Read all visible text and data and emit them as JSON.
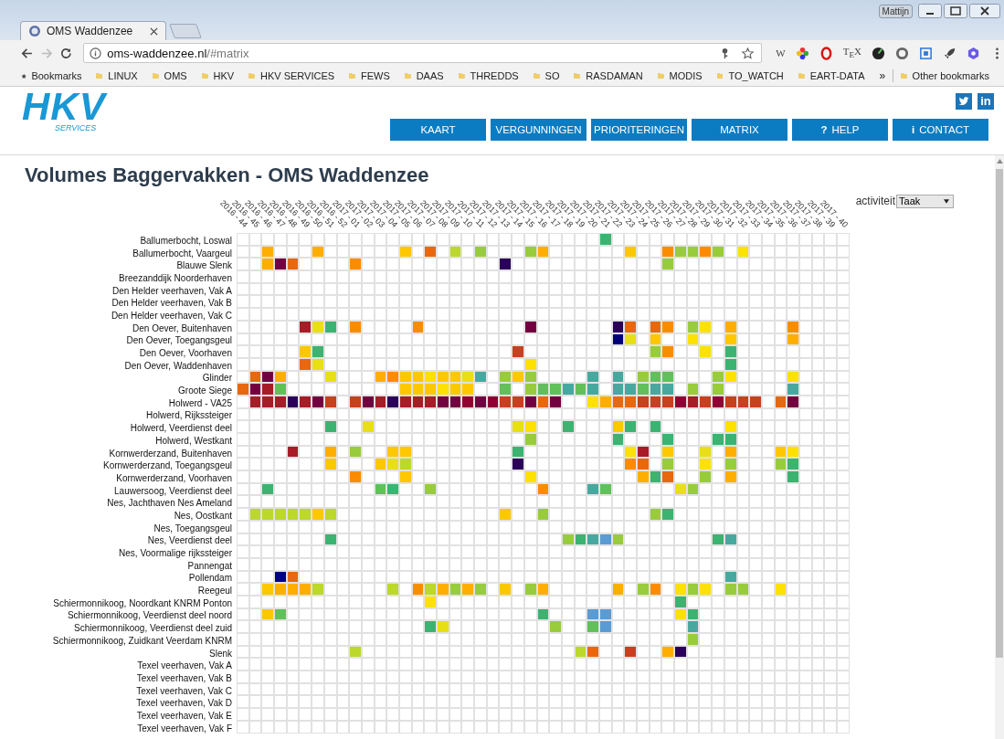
{
  "browser": {
    "user": "Mattijn",
    "tab": {
      "title": "OMS Waddenzee"
    },
    "address": {
      "host": "oms-waddenzee.nl",
      "path": "/#matrix"
    },
    "extensions": [
      {
        "kind": "letter",
        "label": "W"
      },
      {
        "kind": "wheel"
      },
      {
        "kind": "opera"
      },
      {
        "kind": "letter",
        "label": "T$_{E}$X"
      },
      {
        "kind": "dark"
      },
      {
        "kind": "ring"
      },
      {
        "kind": "target"
      },
      {
        "kind": "rocket"
      },
      {
        "kind": "hex"
      }
    ],
    "bookmarks": {
      "label": "Bookmarks",
      "folders": [
        "LINUX",
        "OMS",
        "HKV",
        "HKV SERVICES",
        "FEWS",
        "DAAS",
        "THREDDS",
        "SO",
        "RASDAMAN",
        "MODIS",
        "TO_WATCH",
        "EART-DATA"
      ],
      "overflow": "»",
      "other": "Other bookmarks"
    }
  },
  "header": {
    "logo": {
      "name": "HKV",
      "tagline": "SERVICES"
    },
    "social": [
      {
        "kind": "twitter"
      },
      {
        "kind": "linkedin",
        "label": "in"
      }
    ],
    "nav": [
      {
        "label": "KAART"
      },
      {
        "label": "VERGUNNINGEN"
      },
      {
        "label": "PRIORITERINGEN"
      },
      {
        "label": "MATRIX"
      },
      {
        "label": "HELP",
        "icon": "?"
      },
      {
        "label": "CONTACT",
        "icon": "i"
      }
    ]
  },
  "page": {
    "title": "Volumes Baggervakken - OMS Waddenzee",
    "filter": {
      "label": "activiteit",
      "value": "Taak"
    }
  },
  "matrix": {
    "columns": [
      "2016 - 44",
      "2016 - 45",
      "2016 - 46",
      "2016 - 47",
      "2016 - 48",
      "2016 - 49",
      "2016 - 50",
      "2016 - 51",
      "2016 - 52",
      "2017 - 01",
      "2017 - 02",
      "2017 - 03",
      "2017 - 04",
      "2017 - 05",
      "2017 - 06",
      "2017 - 07",
      "2017 - 08",
      "2017 - 09",
      "2017 - 10",
      "2017 - 11",
      "2017 - 12",
      "2017 - 13",
      "2017 - 14",
      "2017 - 15",
      "2017 - 16",
      "2017 - 17",
      "2017 - 18",
      "2017 - 19",
      "2017 - 20",
      "2017 - 21",
      "2017 - 22",
      "2017 - 23",
      "2017 - 24",
      "2017 - 25",
      "2017 - 26",
      "2017 - 27",
      "2017 - 28",
      "2017 - 29",
      "2017 - 30",
      "2017 - 31",
      "2017 - 32",
      "2017 - 33",
      "2017 - 34",
      "2017 - 35",
      "2017 - 36",
      "2017 - 37",
      "2017 - 38",
      "2017 - 39",
      "2017 - 40"
    ],
    "rows": [
      {
        "label": "Ballumerbocht, Loswal",
        "cells": [
          null,
          null,
          null,
          null,
          null,
          null,
          null,
          null,
          null,
          null,
          null,
          null,
          null,
          null,
          null,
          null,
          null,
          null,
          null,
          null,
          null,
          null,
          null,
          null,
          null,
          null,
          null,
          null,
          null,
          {
            "color": "#3cb371"
          },
          null,
          null,
          null,
          null,
          null,
          null,
          null,
          null,
          null,
          null,
          null,
          null,
          null,
          null,
          null,
          null,
          null,
          null,
          null
        ]
      },
      {
        "label": "Ballumerbocht, Vaargeul",
        "cells": [
          null,
          null,
          {
            "color": "#fdae00"
          },
          null,
          null,
          null,
          {
            "color": "#fdae00"
          },
          null,
          null,
          null,
          null,
          null,
          null,
          {
            "color": "#fdc800"
          },
          null,
          {
            "color": "#e8680f"
          },
          null,
          {
            "color": "#bcd82a"
          },
          null,
          {
            "color": "#98cc3c"
          },
          null,
          null,
          null,
          {
            "color": "#98cc3c"
          },
          {
            "color": "#fdae00"
          },
          null,
          null,
          null,
          null,
          null,
          null,
          {
            "color": "#fdc800"
          },
          null,
          null,
          {
            "color": "#fb8c00"
          },
          {
            "color": "#98cc3c"
          },
          {
            "color": "#98cc3c"
          },
          {
            "color": "#fb8c00"
          },
          {
            "color": "#98cc3c"
          },
          null,
          {
            "color": "#fde100"
          },
          null,
          null,
          null,
          null,
          null,
          null,
          null,
          null
        ]
      },
      {
        "label": "Blauwe Slenk",
        "cells": [
          null,
          null,
          {
            "color": "#fdae00"
          },
          {
            "color": "#720040"
          },
          {
            "color": "#e8680f"
          },
          null,
          null,
          null,
          null,
          {
            "color": "#fb8c00"
          },
          null,
          null,
          null,
          null,
          null,
          null,
          null,
          null,
          null,
          null,
          null,
          {
            "color": "#2a0058"
          },
          null,
          null,
          null,
          null,
          null,
          null,
          null,
          null,
          null,
          null,
          null,
          null,
          {
            "color": "#98cc3c"
          },
          null,
          null,
          null,
          null,
          null,
          null,
          null,
          null,
          null,
          null,
          null,
          null,
          null,
          null
        ]
      },
      {
        "label": "Breezanddijk Noorderhaven"
      },
      {
        "label": "Den Helder veerhaven, Vak A"
      },
      {
        "label": "Den Helder veerhaven, Vak B"
      },
      {
        "label": "Den Helder veerhaven, Vak C"
      },
      {
        "label": "Den Oever, Buitenhaven",
        "cells": [
          null,
          null,
          null,
          null,
          null,
          {
            "color": "#a81c28"
          },
          {
            "color": "#e8e014"
          },
          {
            "color": "#3cb371"
          },
          null,
          {
            "color": "#fb8c00"
          },
          null,
          null,
          null,
          null,
          {
            "color": "#fb8c00"
          },
          null,
          null,
          null,
          null,
          null,
          null,
          null,
          null,
          {
            "color": "#720040"
          },
          null,
          null,
          null,
          null,
          null,
          null,
          {
            "color": "#2a0058"
          },
          {
            "color": "#e8680f"
          },
          null,
          {
            "color": "#e8680f"
          },
          {
            "color": "#fb8c00"
          },
          null,
          {
            "color": "#98cc3c"
          },
          {
            "color": "#fde100"
          },
          null,
          {
            "color": "#fdae00"
          },
          null,
          null,
          null,
          null,
          {
            "color": "#fb8c00"
          },
          null,
          null,
          null,
          null
        ]
      },
      {
        "label": "Den Oever, Toegangsgeul",
        "cells": [
          null,
          null,
          null,
          null,
          null,
          null,
          null,
          null,
          null,
          null,
          null,
          null,
          null,
          null,
          null,
          null,
          null,
          null,
          null,
          null,
          null,
          null,
          null,
          null,
          null,
          null,
          null,
          null,
          null,
          null,
          {
            "color": "#000080"
          },
          {
            "color": "#e8e014"
          },
          null,
          {
            "color": "#fdc800"
          },
          null,
          null,
          {
            "color": "#fde100"
          },
          null,
          null,
          {
            "color": "#fdc800"
          },
          null,
          null,
          null,
          null,
          {
            "color": "#fdae00"
          },
          null,
          null,
          null,
          null
        ]
      },
      {
        "label": "Den Oever, Voorhaven",
        "cells": [
          null,
          null,
          null,
          null,
          null,
          {
            "color": "#fdc800"
          },
          {
            "color": "#3cb371"
          },
          null,
          null,
          null,
          null,
          null,
          null,
          null,
          null,
          null,
          null,
          null,
          null,
          null,
          null,
          null,
          {
            "color": "#c8401e"
          },
          null,
          null,
          null,
          null,
          null,
          null,
          null,
          null,
          null,
          null,
          {
            "color": "#98cc3c"
          },
          {
            "color": "#fb8c00"
          },
          null,
          null,
          {
            "color": "#fde100"
          },
          null,
          {
            "color": "#3cb371"
          },
          null,
          null,
          null,
          null,
          null,
          null,
          null,
          null,
          null
        ]
      },
      {
        "label": "Den Oever, Waddenhaven",
        "cells": [
          null,
          null,
          null,
          null,
          null,
          {
            "color": "#e8680f"
          },
          {
            "color": "#e8e014"
          },
          null,
          null,
          null,
          null,
          null,
          null,
          null,
          null,
          null,
          null,
          null,
          null,
          null,
          null,
          null,
          null,
          {
            "color": "#fde100"
          },
          null,
          null,
          null,
          null,
          null,
          null,
          null,
          null,
          null,
          null,
          null,
          null,
          null,
          null,
          null,
          {
            "color": "#3cb371"
          },
          null,
          null,
          null,
          null,
          null,
          null,
          null,
          null,
          null
        ]
      },
      {
        "label": "Glinder",
        "cells": [
          null,
          {
            "color": "#e8680f"
          },
          {
            "color": "#720040"
          },
          {
            "color": "#fdae00"
          },
          null,
          null,
          null,
          {
            "color": "#e8e014"
          },
          null,
          null,
          null,
          {
            "color": "#fdae00"
          },
          {
            "color": "#fb8c00"
          },
          {
            "color": "#fdc800"
          },
          {
            "color": "#fdc800"
          },
          {
            "color": "#fde100"
          },
          {
            "color": "#fdc800"
          },
          {
            "color": "#fdc800"
          },
          {
            "color": "#e8e014"
          },
          {
            "color": "#48a8a0"
          },
          null,
          {
            "color": "#98cc3c"
          },
          {
            "color": "#fdc800"
          },
          {
            "color": "#98cc3c"
          },
          null,
          null,
          null,
          null,
          {
            "color": "#48a8a0"
          },
          null,
          {
            "color": "#48a8a0"
          },
          null,
          {
            "color": "#98cc3c"
          },
          {
            "color": "#62c05a"
          },
          {
            "color": "#62c05a"
          },
          null,
          null,
          null,
          {
            "color": "#98cc3c"
          },
          {
            "color": "#fde100"
          },
          null,
          null,
          null,
          null,
          {
            "color": "#fde100"
          },
          null,
          null,
          null,
          null
        ]
      },
      {
        "label": "Groote Siege",
        "cells": [
          {
            "color": "#e8680f"
          },
          {
            "color": "#720040"
          },
          {
            "color": "#a81c28"
          },
          {
            "color": "#62c05a"
          },
          null,
          null,
          null,
          null,
          null,
          null,
          null,
          null,
          null,
          {
            "color": "#fdc800"
          },
          {
            "color": "#fdc800"
          },
          {
            "color": "#fdc800"
          },
          {
            "color": "#fde100"
          },
          {
            "color": "#fdc800"
          },
          {
            "color": "#fdc800"
          },
          null,
          null,
          {
            "color": "#62c05a"
          },
          null,
          {
            "color": "#98cc3c"
          },
          {
            "color": "#62c05a"
          },
          {
            "color": "#62c05a"
          },
          {
            "color": "#48a8a0"
          },
          {
            "color": "#62c05a"
          },
          {
            "color": "#48a8a0"
          },
          null,
          {
            "color": "#48a8a0"
          },
          {
            "color": "#48a8a0"
          },
          {
            "color": "#62c05a"
          },
          {
            "color": "#48a8a0"
          },
          {
            "color": "#48a8a0"
          },
          null,
          {
            "color": "#98cc3c"
          },
          null,
          {
            "color": "#98cc3c"
          },
          null,
          null,
          null,
          null,
          null,
          {
            "color": "#48a8a0"
          },
          null,
          null,
          null,
          null
        ]
      },
      {
        "label": "Holwerd - VA25",
        "cells": [
          null,
          {
            "color": "#a81c28"
          },
          {
            "color": "#a81c28"
          },
          {
            "color": "#a81c28"
          },
          {
            "color": "#2a0058"
          },
          {
            "color": "#a81c28"
          },
          {
            "color": "#720040"
          },
          {
            "color": "#c8401e"
          },
          null,
          {
            "color": "#c8401e"
          },
          {
            "color": "#720040"
          },
          {
            "color": "#a81c28"
          },
          {
            "color": "#2a0058"
          },
          {
            "color": "#a81c28"
          },
          {
            "color": "#a81c28"
          },
          {
            "color": "#a81c28"
          },
          {
            "color": "#720040"
          },
          {
            "color": "#720040"
          },
          {
            "color": "#900032"
          },
          {
            "color": "#720040"
          },
          {
            "color": "#900032"
          },
          {
            "color": "#c8401e"
          },
          {
            "color": "#c8401e"
          },
          {
            "color": "#720040"
          },
          {
            "color": "#e8680f"
          },
          {
            "color": "#720040"
          },
          null,
          null,
          {
            "color": "#fde100"
          },
          {
            "color": "#fdae00"
          },
          {
            "color": "#e8680f"
          },
          {
            "color": "#e8680f"
          },
          {
            "color": "#c8401e"
          },
          {
            "color": "#c8401e"
          },
          {
            "color": "#c8401e"
          },
          {
            "color": "#900032"
          },
          {
            "color": "#a81c28"
          },
          {
            "color": "#c8401e"
          },
          {
            "color": "#900032"
          },
          {
            "color": "#c8401e"
          },
          {
            "color": "#c8401e"
          },
          {
            "color": "#c8401e"
          },
          null,
          {
            "color": "#e8680f"
          },
          {
            "color": "#720040"
          },
          null,
          null,
          null,
          null
        ]
      },
      {
        "label": "Holwerd, Rijkssteiger"
      },
      {
        "label": "Holwerd, Veerdienst deel",
        "cells": [
          null,
          null,
          null,
          null,
          null,
          null,
          null,
          {
            "color": "#3cb371"
          },
          null,
          null,
          {
            "color": "#e8e014"
          },
          null,
          null,
          null,
          null,
          null,
          null,
          null,
          null,
          null,
          null,
          null,
          {
            "color": "#e8e014"
          },
          {
            "color": "#fde100"
          },
          null,
          null,
          {
            "color": "#3cb371"
          },
          null,
          null,
          null,
          {
            "color": "#fdc800"
          },
          {
            "color": "#3cb371"
          },
          null,
          {
            "color": "#3cb371"
          },
          null,
          null,
          null,
          null,
          null,
          {
            "color": "#fde100"
          },
          null,
          null,
          null,
          null,
          null,
          null,
          null,
          null,
          null
        ]
      },
      {
        "label": "Holwerd, Westkant",
        "cells": [
          null,
          null,
          null,
          null,
          null,
          null,
          null,
          null,
          null,
          null,
          null,
          null,
          null,
          null,
          null,
          null,
          null,
          null,
          null,
          null,
          null,
          null,
          null,
          {
            "color": "#98cc3c"
          },
          null,
          null,
          null,
          null,
          null,
          null,
          {
            "color": "#3cb371"
          },
          null,
          null,
          null,
          {
            "color": "#3cb371"
          },
          null,
          null,
          null,
          {
            "color": "#3cb371"
          },
          {
            "color": "#3cb371"
          },
          null,
          null,
          null,
          null,
          null,
          null,
          null,
          null,
          null
        ]
      },
      {
        "label": "Kornwerderzand, Buitenhaven",
        "cells": [
          null,
          null,
          null,
          null,
          {
            "color": "#a81c28"
          },
          null,
          null,
          {
            "color": "#fdae00"
          },
          null,
          {
            "color": "#98cc3c"
          },
          null,
          null,
          {
            "color": "#fdc800"
          },
          {
            "color": "#fdc800"
          },
          null,
          null,
          null,
          null,
          null,
          null,
          null,
          null,
          {
            "color": "#3cb371"
          },
          null,
          null,
          null,
          null,
          null,
          null,
          null,
          null,
          {
            "color": "#fde100"
          },
          {
            "color": "#a81c28"
          },
          null,
          {
            "color": "#fdc800"
          },
          null,
          null,
          {
            "color": "#e8e014"
          },
          null,
          {
            "color": "#fdae00"
          },
          null,
          null,
          null,
          {
            "color": "#fdc800"
          },
          {
            "color": "#fde100"
          },
          null,
          null,
          null,
          null
        ]
      },
      {
        "label": "Kornwerderzand, Toegangsgeul",
        "cells": [
          null,
          null,
          null,
          null,
          null,
          null,
          null,
          {
            "color": "#fdc800"
          },
          null,
          null,
          null,
          {
            "color": "#fdc800"
          },
          {
            "color": "#e8e014"
          },
          {
            "color": "#bcd82a"
          },
          null,
          null,
          null,
          null,
          null,
          null,
          null,
          null,
          {
            "color": "#2a0058"
          },
          null,
          null,
          null,
          null,
          null,
          null,
          null,
          null,
          {
            "color": "#fb8c00"
          },
          {
            "color": "#e8680f"
          },
          null,
          {
            "color": "#98cc3c"
          },
          null,
          null,
          {
            "color": "#fde100"
          },
          null,
          {
            "color": "#98cc3c"
          },
          null,
          null,
          null,
          {
            "color": "#98cc3c"
          },
          {
            "color": "#3cb371"
          },
          null,
          null,
          null,
          null
        ]
      },
      {
        "label": "Kornwerderzand, Voorhaven",
        "cells": [
          null,
          null,
          null,
          null,
          null,
          null,
          null,
          null,
          null,
          {
            "color": "#fb8c00"
          },
          null,
          null,
          null,
          {
            "color": "#fdc800"
          },
          null,
          null,
          null,
          null,
          null,
          null,
          null,
          null,
          null,
          {
            "color": "#fde100"
          },
          null,
          null,
          null,
          null,
          null,
          null,
          null,
          null,
          {
            "color": "#fdae00"
          },
          {
            "color": "#3cb371"
          },
          {
            "color": "#e8680f"
          },
          null,
          null,
          {
            "color": "#98cc3c"
          },
          null,
          {
            "color": "#fdae00"
          },
          null,
          null,
          null,
          null,
          {
            "color": "#3cb371"
          },
          null,
          null,
          null,
          null
        ]
      },
      {
        "label": "Lauwersoog, Veerdienst deel",
        "cells": [
          null,
          null,
          {
            "color": "#3cb371"
          },
          null,
          null,
          null,
          null,
          null,
          null,
          null,
          null,
          {
            "color": "#62c05a"
          },
          {
            "color": "#3cb371"
          },
          null,
          null,
          {
            "color": "#98cc3c"
          },
          null,
          null,
          null,
          null,
          null,
          null,
          null,
          null,
          {
            "color": "#fb8c00"
          },
          null,
          null,
          null,
          {
            "color": "#48a8a0"
          },
          {
            "color": "#62c05a"
          },
          null,
          null,
          null,
          null,
          null,
          {
            "color": "#e8e014"
          },
          {
            "color": "#98cc3c"
          },
          null,
          null,
          null,
          null,
          null,
          null,
          null,
          null,
          null,
          null,
          null,
          null
        ]
      },
      {
        "label": "Nes, Jachthaven Nes Ameland"
      },
      {
        "label": "Nes, Oostkant",
        "cells": [
          null,
          {
            "color": "#bcd82a"
          },
          {
            "color": "#bcd82a"
          },
          {
            "color": "#bcd82a"
          },
          {
            "color": "#bcd82a"
          },
          {
            "color": "#bcd82a"
          },
          {
            "color": "#fdc800"
          },
          {
            "color": "#bcd82a"
          },
          null,
          null,
          null,
          null,
          null,
          null,
          null,
          null,
          null,
          null,
          null,
          null,
          null,
          {
            "color": "#fdc800"
          },
          null,
          null,
          {
            "color": "#98cc3c"
          },
          null,
          null,
          null,
          null,
          null,
          null,
          null,
          null,
          {
            "color": "#98cc3c"
          },
          {
            "color": "#3cb371"
          },
          null,
          null,
          null,
          null,
          null,
          null,
          null,
          null,
          null,
          null,
          null,
          null,
          null,
          null
        ]
      },
      {
        "label": "Nes, Toegangsgeul"
      },
      {
        "label": "Nes, Veerdienst deel",
        "cells": [
          null,
          null,
          null,
          null,
          null,
          null,
          null,
          {
            "color": "#3cb371"
          },
          null,
          null,
          null,
          null,
          null,
          null,
          null,
          null,
          null,
          null,
          null,
          null,
          null,
          null,
          null,
          null,
          null,
          null,
          {
            "color": "#98cc3c"
          },
          {
            "color": "#3cb371"
          },
          {
            "color": "#48a8a0"
          },
          {
            "color": "#5a9bd4"
          },
          {
            "color": "#98cc3c"
          },
          null,
          null,
          null,
          null,
          null,
          null,
          null,
          {
            "color": "#3cb371"
          },
          {
            "color": "#48a8a0"
          },
          null,
          null,
          null,
          null,
          null,
          null,
          null,
          null,
          null
        ]
      },
      {
        "label": "Nes, Voormalige rijkssteiger"
      },
      {
        "label": "Pannengat"
      },
      {
        "label": "Pollendam",
        "cells": [
          null,
          null,
          null,
          {
            "color": "#000080"
          },
          {
            "color": "#e8680f"
          },
          null,
          null,
          null,
          null,
          null,
          null,
          null,
          null,
          null,
          null,
          null,
          null,
          null,
          null,
          null,
          null,
          null,
          null,
          null,
          null,
          null,
          null,
          null,
          null,
          null,
          null,
          null,
          null,
          null,
          null,
          null,
          null,
          null,
          null,
          {
            "color": "#48a8a0"
          },
          null,
          null,
          null,
          null,
          null,
          null,
          null,
          null,
          null
        ]
      },
      {
        "label": "Reegeul",
        "cells": [
          null,
          null,
          {
            "color": "#fdc800"
          },
          {
            "color": "#fdae00"
          },
          {
            "color": "#fdae00"
          },
          {
            "color": "#fdae00"
          },
          {
            "color": "#bcd82a"
          },
          null,
          null,
          null,
          null,
          null,
          {
            "color": "#bcd82a"
          },
          null,
          {
            "color": "#fb8c00"
          },
          {
            "color": "#bcd82a"
          },
          {
            "color": "#fdae00"
          },
          {
            "color": "#98cc3c"
          },
          {
            "color": "#fdae00"
          },
          {
            "color": "#98cc3c"
          },
          null,
          {
            "color": "#fdc800"
          },
          null,
          {
            "color": "#98cc3c"
          },
          {
            "color": "#fdae00"
          },
          null,
          null,
          null,
          null,
          null,
          {
            "color": "#fdae00"
          },
          null,
          {
            "color": "#98cc3c"
          },
          {
            "color": "#fb8c00"
          },
          null,
          {
            "color": "#fde100"
          },
          {
            "color": "#98cc3c"
          },
          {
            "color": "#fde100"
          },
          null,
          {
            "color": "#98cc3c"
          },
          {
            "color": "#98cc3c"
          },
          null,
          null,
          {
            "color": "#fde100"
          },
          null,
          null,
          null,
          null,
          null
        ]
      },
      {
        "label": "Schiermonnikoog, Noordkant KNRM Ponton",
        "cells": [
          null,
          null,
          null,
          null,
          null,
          null,
          null,
          null,
          null,
          null,
          null,
          null,
          null,
          null,
          null,
          {
            "color": "#fde100"
          },
          null,
          null,
          null,
          null,
          null,
          null,
          null,
          null,
          null,
          null,
          null,
          null,
          null,
          null,
          null,
          null,
          null,
          null,
          null,
          {
            "color": "#3cb371"
          },
          null,
          null,
          null,
          null,
          null,
          null,
          null,
          null,
          null,
          null,
          null,
          null,
          null
        ]
      },
      {
        "label": "Schiermonnikoog, Veerdienst deel noord",
        "cells": [
          null,
          null,
          {
            "color": "#fdc800"
          },
          {
            "color": "#62c05a"
          },
          null,
          null,
          null,
          null,
          null,
          null,
          null,
          null,
          null,
          null,
          null,
          null,
          null,
          null,
          null,
          null,
          null,
          null,
          null,
          null,
          {
            "color": "#3cb371"
          },
          null,
          null,
          null,
          {
            "color": "#5a9bd4"
          },
          {
            "color": "#5a9bd4"
          },
          null,
          null,
          null,
          null,
          null,
          {
            "color": "#fde100"
          },
          {
            "color": "#3cb371"
          },
          null,
          null,
          null,
          null,
          null,
          null,
          null,
          null,
          null,
          null,
          null,
          null
        ]
      },
      {
        "label": "Schiermonnikoog, Veerdienst deel zuid",
        "cells": [
          null,
          null,
          null,
          null,
          null,
          null,
          null,
          null,
          null,
          null,
          null,
          null,
          null,
          null,
          null,
          {
            "color": "#3cb371"
          },
          {
            "color": "#e8e014"
          },
          null,
          null,
          null,
          null,
          null,
          null,
          null,
          null,
          {
            "color": "#98cc3c"
          },
          null,
          null,
          {
            "color": "#62c05a"
          },
          {
            "color": "#5a9bd4"
          },
          null,
          null,
          null,
          null,
          null,
          null,
          {
            "color": "#48a8a0"
          },
          null,
          null,
          null,
          null,
          null,
          null,
          null,
          null,
          null,
          null,
          null,
          null
        ]
      },
      {
        "label": "Schiermonnikoog, Zuidkant Veerdam KNRM",
        "cells": [
          null,
          null,
          null,
          null,
          null,
          null,
          null,
          null,
          null,
          null,
          null,
          null,
          null,
          null,
          null,
          null,
          null,
          null,
          null,
          null,
          null,
          null,
          null,
          null,
          null,
          null,
          null,
          null,
          null,
          null,
          null,
          null,
          null,
          null,
          null,
          null,
          {
            "color": "#98cc3c"
          },
          null,
          null,
          null,
          null,
          null,
          null,
          null,
          null,
          null,
          null,
          null,
          null
        ]
      },
      {
        "label": "Slenk",
        "cells": [
          null,
          null,
          null,
          null,
          null,
          null,
          null,
          null,
          null,
          {
            "color": "#bcd82a"
          },
          null,
          null,
          null,
          null,
          null,
          null,
          null,
          null,
          null,
          null,
          null,
          null,
          null,
          null,
          null,
          null,
          null,
          {
            "color": "#bcd82a"
          },
          {
            "color": "#e8680f"
          },
          null,
          null,
          {
            "color": "#c8401e"
          },
          null,
          null,
          {
            "color": "#fdae00"
          },
          {
            "color": "#2a0058"
          },
          null,
          null,
          null,
          null,
          null,
          null,
          null,
          null,
          null,
          null,
          null,
          null,
          null
        ]
      },
      {
        "label": "Texel veerhaven, Vak A"
      },
      {
        "label": "Texel veerhaven, Vak B"
      },
      {
        "label": "Texel veerhaven, Vak C"
      },
      {
        "label": "Texel veerhaven, Vak D"
      },
      {
        "label": "Texel veerhaven, Vak E"
      },
      {
        "label": "Texel veerhaven, Vak F"
      }
    ]
  }
}
